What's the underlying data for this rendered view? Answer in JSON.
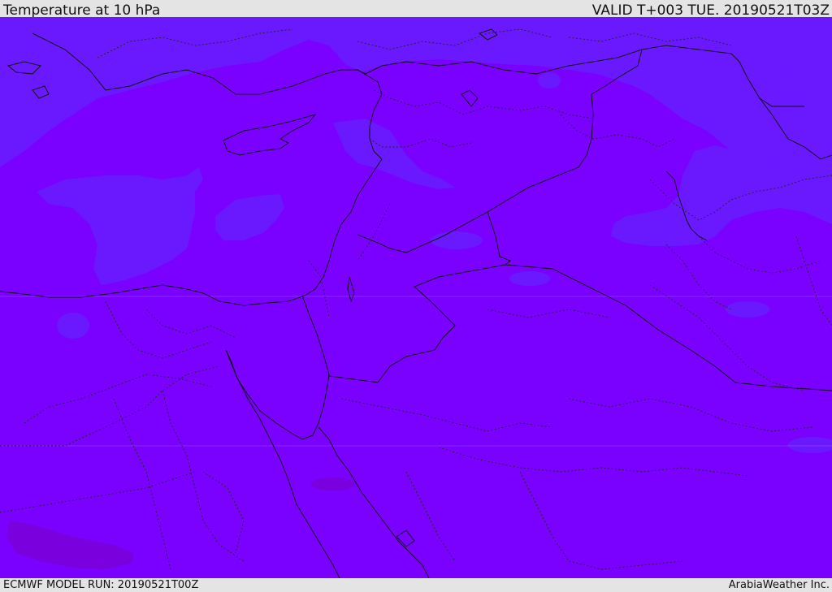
{
  "header": {
    "title": "Temperature at 10 hPa",
    "valid": "VALID T+003 TUE. 20190521T03Z"
  },
  "footer": {
    "model_run": "ECMWF MODEL RUN: 20190521T00Z",
    "credit": "ArabiaWeather Inc."
  },
  "map": {
    "background_color": "#7a00ff",
    "cool_shade_color": "#6a19ff",
    "warm_shade_color": "#7a00dd"
  }
}
